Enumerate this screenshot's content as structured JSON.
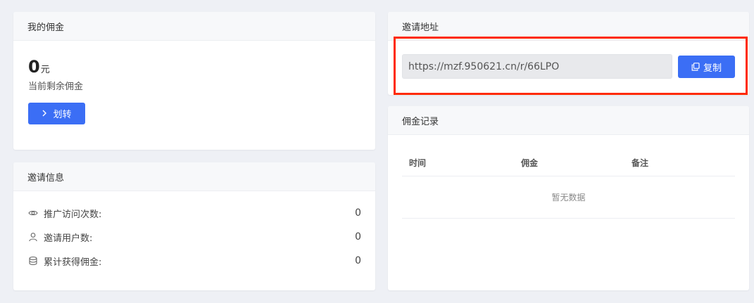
{
  "commission_card": {
    "title": "我的佣金",
    "amount": "0",
    "unit": "元",
    "remaining_label": "当前剩余佣金",
    "transfer_label": "划转"
  },
  "invite_info": {
    "title": "邀请信息",
    "stats": [
      {
        "icon": "eye-icon",
        "label": "推广访问次数:",
        "value": "0"
      },
      {
        "icon": "user-icon",
        "label": "邀请用户数:",
        "value": "0"
      },
      {
        "icon": "database-icon",
        "label": "累计获得佣金:",
        "value": "0"
      }
    ]
  },
  "invite_url": {
    "title": "邀请地址",
    "url": "https://mzf.950621.cn/r/66LPO",
    "copy_label": "复制"
  },
  "records": {
    "title": "佣金记录",
    "columns": [
      "时间",
      "佣金",
      "备注"
    ],
    "empty_text": "暂无数据"
  },
  "colors": {
    "primary": "#3b6ef5",
    "highlight": "#ff2a00",
    "background": "#eef0f5"
  }
}
